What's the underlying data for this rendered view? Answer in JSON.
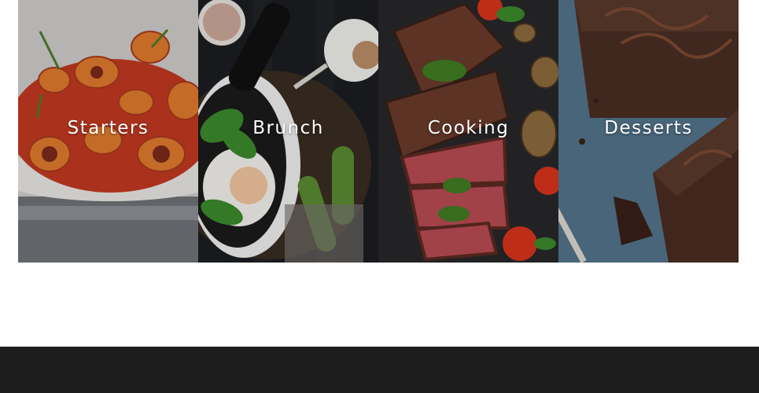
{
  "categories": [
    {
      "label": "Starters",
      "image": "pasta-photo"
    },
    {
      "label": "Brunch",
      "image": "egg-pan-photo"
    },
    {
      "label": "Cooking",
      "image": "steak-photo"
    },
    {
      "label": "Desserts",
      "image": "brownie-photo"
    }
  ],
  "colors": {
    "footer": "#1d1d1d",
    "label_text": "#ffffff"
  }
}
